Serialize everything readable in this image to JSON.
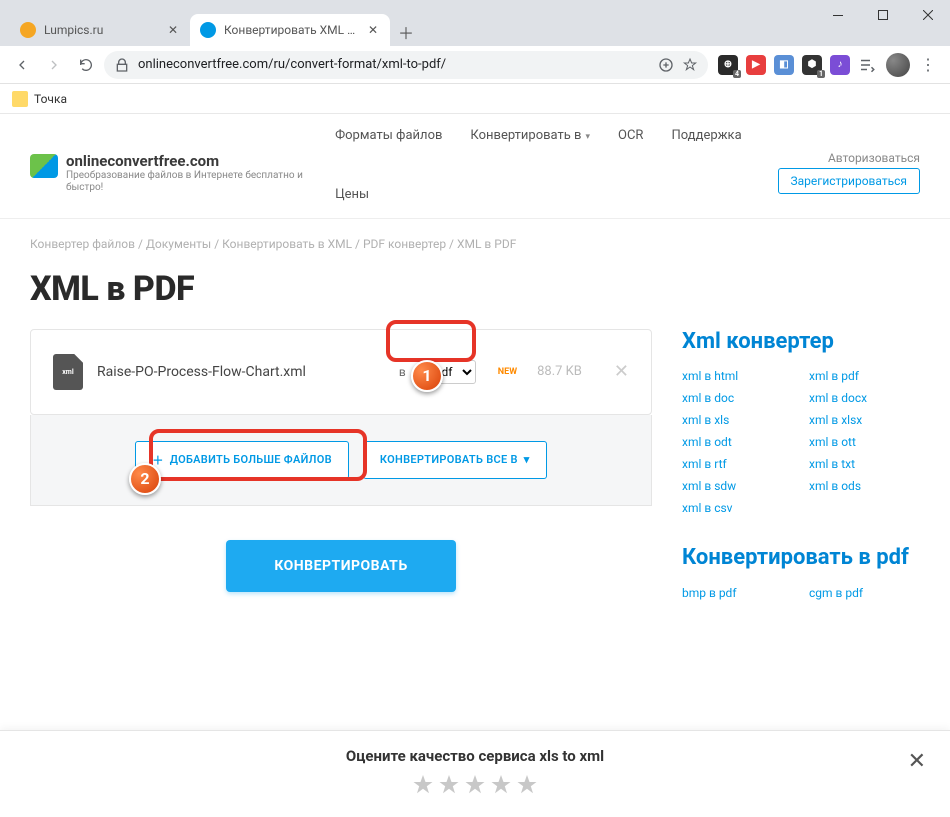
{
  "browser": {
    "tabs": [
      {
        "title": "Lumpics.ru",
        "favicon": "#f5a623",
        "active": false
      },
      {
        "title": "Конвертировать XML в PDF онл",
        "favicon": "#0099e5",
        "active": true
      }
    ],
    "url": "onlineconvertfree.com/ru/convert-format/xml-to-pdf/",
    "bookmark": "Точка"
  },
  "site": {
    "logo_name": "onlineconvertfree.com",
    "logo_sub": "Преобразование файлов в Интернете бесплатно и быстро!",
    "nav": {
      "formats": "Форматы файлов",
      "convert_to": "Конвертировать в",
      "ocr": "OCR",
      "support": "Поддержка",
      "prices": "Цены"
    },
    "auth": {
      "login": "Авторизоваться",
      "register": "Зарегистрироваться"
    }
  },
  "breadcrumbs": {
    "p0": "Конвертер файлов",
    "p1": "Документы",
    "p2": "Конвертировать в XML",
    "p3": "PDF конвертер",
    "p4": "XML в PDF",
    "sep": " / "
  },
  "h1": "XML в PDF",
  "file": {
    "icon_label": "xml",
    "name": "Raise-PO-Process-Flow-Chart.xml",
    "to_label": "в",
    "format": "pdf",
    "new": "NEW",
    "size": "88.7 KB"
  },
  "buttons": {
    "add_more": "ДОБАВИТЬ БОЛЬШЕ ФАЙЛОВ",
    "convert_all": "КОНВЕРТИРОВАТЬ ВСЕ В",
    "convert": "КОНВЕРТИРОВАТЬ"
  },
  "markers": {
    "m1": "1",
    "m2": "2"
  },
  "sidebar": {
    "h1": "Xml конвертер",
    "links1": [
      "xml в html",
      "xml в pdf",
      "xml в doc",
      "xml в docx",
      "xml в xls",
      "xml в xlsx",
      "xml в odt",
      "xml в ott",
      "xml в rtf",
      "xml в txt",
      "xml в sdw",
      "xml в ods",
      "xml в csv",
      ""
    ],
    "h2": "Конвертировать в pdf",
    "links2": [
      "bmp в pdf",
      "cgm в pdf"
    ]
  },
  "rating": {
    "title": "Оцените качество сервиса xls to xml"
  }
}
